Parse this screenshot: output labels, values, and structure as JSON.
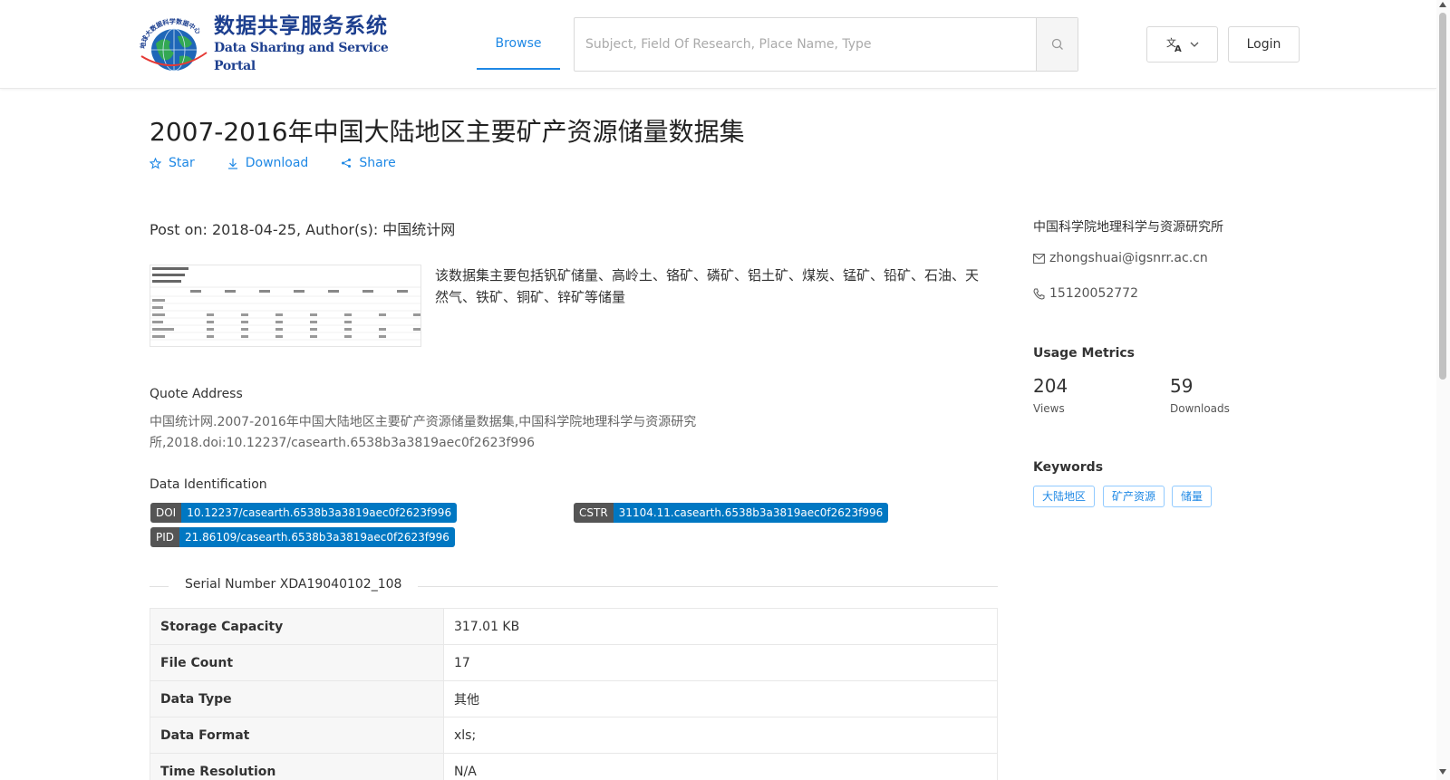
{
  "header": {
    "logo_cn": "数据共享服务系统",
    "logo_en": "Data Sharing and Service Portal",
    "logo_ring_text": "地球大数据科学数据中心",
    "nav_browse": "Browse",
    "search_placeholder": "Subject, Field Of Research, Place Name, Type",
    "login": "Login"
  },
  "dataset": {
    "title": "2007-2016年中国大陆地区主要矿产资源储量数据集",
    "actions": {
      "star": "Star",
      "download": "Download",
      "share": "Share"
    },
    "post_info": "Post on: 2018-04-25, Author(s): 中国统计网",
    "description": "该数据集主要包括钒矿储量、高岭土、铬矿、磷矿、铝土矿、煤炭、锰矿、铅矿、石油、天然气、铁矿、铜矿、锌矿等储量",
    "quote_label": "Quote Address",
    "quote_text": "中国统计网.2007-2016年中国大陆地区主要矿产资源储量数据集,中国科学院地理科学与资源研究所,2018.doi:10.12237/casearth.6538b3a3819aec0f2623f996",
    "id_label": "Data Identification",
    "ids": {
      "doi_key": "DOI",
      "doi_val": "10.12237/casearth.6538b3a3819aec0f2623f996",
      "cstr_key": "CSTR",
      "cstr_val": "31104.11.casearth.6538b3a3819aec0f2623f996",
      "pid_key": "PID",
      "pid_val": "21.86109/casearth.6538b3a3819aec0f2623f996"
    },
    "serial": "Serial Number XDA19040102_108",
    "info": [
      {
        "k": "Storage Capacity",
        "v": "317.01 KB"
      },
      {
        "k": "File Count",
        "v": "17"
      },
      {
        "k": "Data Type",
        "v": "其他"
      },
      {
        "k": "Data Format",
        "v": "xls;"
      },
      {
        "k": "Time Resolution",
        "v": "N/A"
      }
    ]
  },
  "sidebar": {
    "institution": "中国科学院地理科学与资源研究所",
    "email": "zhongshuai@igsnrr.ac.cn",
    "phone": "15120052772",
    "usage_title": "Usage Metrics",
    "views_num": "204",
    "views_lbl": "Views",
    "downloads_num": "59",
    "downloads_lbl": "Downloads",
    "keywords_title": "Keywords",
    "keywords": [
      "大陆地区",
      "矿产资源",
      "储量"
    ]
  },
  "colors": {
    "accent": "#1e88e5",
    "badge_val": "#0077c2",
    "badge_key": "#555555",
    "logo": "#1d3f8f"
  }
}
